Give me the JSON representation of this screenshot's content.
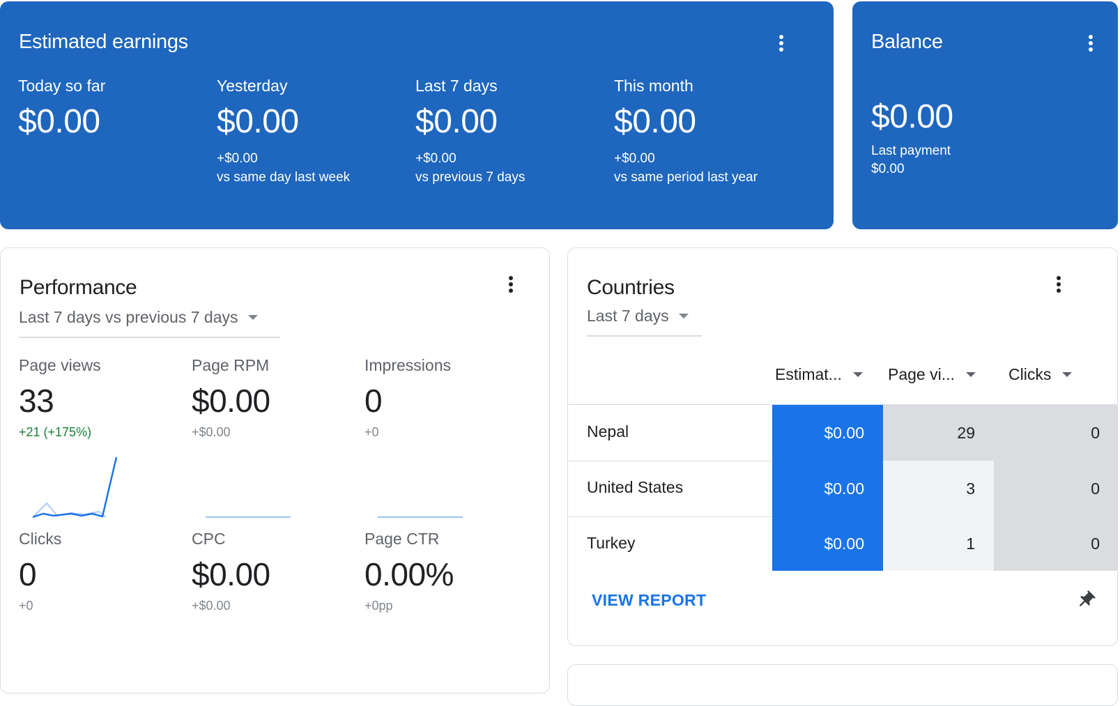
{
  "earnings": {
    "title": "Estimated earnings",
    "stats": [
      {
        "label": "Today so far",
        "value": "$0.00",
        "delta": "",
        "comparison": ""
      },
      {
        "label": "Yesterday",
        "value": "$0.00",
        "delta": "+$0.00",
        "comparison": "vs same day last week"
      },
      {
        "label": "Last 7 days",
        "value": "$0.00",
        "delta": "+$0.00",
        "comparison": "vs previous 7 days"
      },
      {
        "label": "This month",
        "value": "$0.00",
        "delta": "+$0.00",
        "comparison": "vs same period last year"
      }
    ]
  },
  "balance": {
    "title": "Balance",
    "value": "$0.00",
    "last_payment_label": "Last payment",
    "last_payment_value": "$0.00"
  },
  "performance": {
    "title": "Performance",
    "range": "Last 7 days vs previous 7 days",
    "metrics": [
      {
        "label": "Page views",
        "value": "33",
        "delta": "+21 (+175%)"
      },
      {
        "label": "Page RPM",
        "value": "$0.00",
        "delta": "+$0.00"
      },
      {
        "label": "Impressions",
        "value": "0",
        "delta": "+0"
      },
      {
        "label": "Clicks",
        "value": "0",
        "delta": "+0"
      },
      {
        "label": "CPC",
        "value": "$0.00",
        "delta": "+$0.00"
      },
      {
        "label": "Page CTR",
        "value": "0.00%",
        "delta": "+0pp"
      }
    ]
  },
  "countries": {
    "title": "Countries",
    "range": "Last 7 days",
    "columns": [
      "Estimat...",
      "Page vi...",
      "Clicks"
    ],
    "rows": [
      {
        "country": "Nepal",
        "earnings": "$0.00",
        "page_views": "29",
        "clicks": "0"
      },
      {
        "country": "United States",
        "earnings": "$0.00",
        "page_views": "3",
        "clicks": "0"
      },
      {
        "country": "Turkey",
        "earnings": "$0.00",
        "page_views": "1",
        "clicks": "0"
      }
    ],
    "view_report": "VIEW REPORT"
  },
  "icons": [
    "more-vert-icon",
    "dropdown-arrow-icon",
    "pin-icon"
  ],
  "colors": {
    "card_blue": "#1e66be",
    "accent_blue": "#1a73e8",
    "positive_green": "#188038",
    "cell_grey": "#dadce0"
  }
}
